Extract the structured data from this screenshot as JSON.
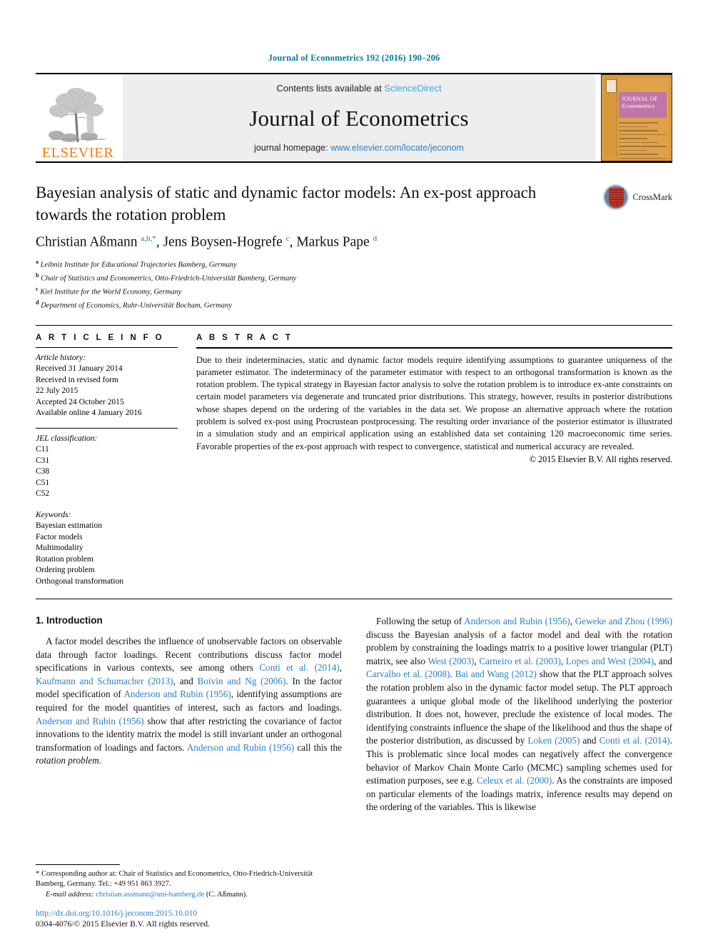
{
  "running_head": "Journal of Econometrics 192 (2016) 190–206",
  "masthead": {
    "publisher": "ELSEVIER",
    "contents_prefix": "Contents lists available at ",
    "contents_link": "ScienceDirect",
    "journal_name": "Journal of Econometrics",
    "homepage_prefix": "journal homepage: ",
    "homepage_url": "www.elsevier.com/locate/jeconom",
    "cover_title_line1": "JOURNAL OF",
    "cover_title_line2": "Econometrics"
  },
  "article": {
    "title": "Bayesian analysis of static and dynamic factor models: An ex-post approach towards the rotation problem",
    "crossmark_label": "CrossMark",
    "authors_html": "Christian Aßmann <sup class=\"star\">a,b,</sup><sup class=\"star\">*</sup>, Jens Boysen-Hogrefe <sup>c</sup>, Markus Pape <sup>d</sup>",
    "affiliations": [
      {
        "marker": "a",
        "text": "Leibniz Institute for Educational Trajectories Bamberg, Germany"
      },
      {
        "marker": "b",
        "text": "Chair of Statistics and Econometrics, Otto-Friedrich-Universität Bamberg, Germany"
      },
      {
        "marker": "c",
        "text": "Kiel Institute for the World Economy, Germany"
      },
      {
        "marker": "d",
        "text": "Department of Economics, Ruhr-Universität Bochum, Germany"
      }
    ]
  },
  "article_info": {
    "heading": "A R T I C L E    I N F O",
    "history_label": "Article history:",
    "history": [
      "Received 31 January 2014",
      "Received in revised form",
      "22 July 2015",
      "Accepted 24 October 2015",
      "Available online 4 January 2016"
    ],
    "jel_label": "JEL classification:",
    "jel_codes": [
      "C11",
      "C31",
      "C38",
      "C51",
      "C52"
    ],
    "keywords_label": "Keywords:",
    "keywords": [
      "Bayesian estimation",
      "Factor models",
      "Multimodality",
      "Rotation problem",
      "Ordering problem",
      "Orthogonal transformation"
    ]
  },
  "abstract": {
    "heading": "A B S T R A C T",
    "text": "Due to their indeterminacies, static and dynamic factor models require identifying assumptions to guarantee uniqueness of the parameter estimator. The indeterminacy of the parameter estimator with respect to an orthogonal transformation is known as the rotation problem. The typical strategy in Bayesian factor analysis to solve the rotation problem is to introduce ex-ante constraints on certain model parameters via degenerate and truncated prior distributions. This strategy, however, results in posterior distributions whose shapes depend on the ordering of the variables in the data set. We propose an alternative approach where the rotation problem is solved ex-post using Procrustean postprocessing. The resulting order invariance of the posterior estimator is illustrated in a simulation study and an empirical application using an established data set containing 120 macroeconomic time series. Favorable properties of the ex-post approach with respect to convergence, statistical and numerical accuracy are revealed.",
    "copyright": "© 2015 Elsevier B.V. All rights reserved."
  },
  "body": {
    "section_number_title": "1.  Introduction",
    "left_paragraph_html": "A factor model describes the influence of unobservable factors on observable data through factor loadings. Recent contributions discuss factor model specifications in various contexts, see among others <span class=\"ref\">Conti et al. (2014)</span>, <span class=\"ref\">Kaufmann and Schumacher (2013)</span>, and <span class=\"ref\">Boivin and Ng (2006)</span>. In the factor model specification of <span class=\"ref\">Anderson and Rubin (1956)</span>, identifying assumptions are required for the model quantities of interest, such as factors and loadings. <span class=\"ref\">Anderson and Rubin (1956)</span> show that after restricting the covariance of factor innovations to the identity matrix the model is still invariant under an orthogonal transformation of loadings and factors. <span class=\"ref\">Anderson and Rubin (1956)</span> call this the <em class=\"it\">rotation problem</em>.",
    "right_paragraph_html": "Following the setup of <span class=\"ref\">Anderson and Rubin (1956)</span>, <span class=\"ref\">Geweke and Zhou (1996)</span> discuss the Bayesian analysis of a factor model and deal with the rotation problem by constraining the loadings matrix to a positive lower triangular (PLT) matrix, see also <span class=\"ref\">West (2003)</span>, <span class=\"ref\">Carneiro et al. (2003)</span>, <span class=\"ref\">Lopes and West (2004)</span>, and <span class=\"ref\">Carvalho et al. (2008)</span>. <span class=\"ref\">Bai and Wang (2012)</span> show that the PLT approach solves the rotation problem also in the dynamic factor model setup. The PLT approach guarantees a unique global mode of the likelihood underlying the posterior distribution. It does not, however, preclude the existence of local modes. The identifying constraints influence the shape of the likelihood and thus the shape of the posterior distribution, as discussed by <span class=\"ref\">Loken (2005)</span> and <span class=\"ref\">Conti et al. (2014)</span>. This is problematic since local modes can negatively affect the convergence behavior of Markov Chain Monte Carlo (MCMC) sampling schemes used for estimation purposes, see e.g. <span class=\"ref\">Celeux et al. (2000)</span>. As the constraints are imposed on particular elements of the loadings matrix, inference results may depend on the ordering of the variables. This is likewise"
  },
  "footnote": {
    "star": "*",
    "corresponding_text": "Corresponding author at: Chair of Statistics and Econometrics, Otto-Friedrich-Universität Bamberg, Germany. Tel.: +49 951 863 3927.",
    "email_label": "E-mail address:",
    "email": "christian.assmann@uni-bamberg.de",
    "email_suffix": "(C. Aßmann).",
    "doi": "http://dx.doi.org/10.1016/j.jeconom.2015.10.010",
    "issn_line": "0304-4076/© 2015 Elsevier B.V. All rights reserved."
  },
  "colors": {
    "link_blue": "#2b7fc4",
    "header_blue": "#0b78a8",
    "elsevier_orange": "#f07d1a",
    "sciencedirect_blue": "#3aaadc"
  }
}
